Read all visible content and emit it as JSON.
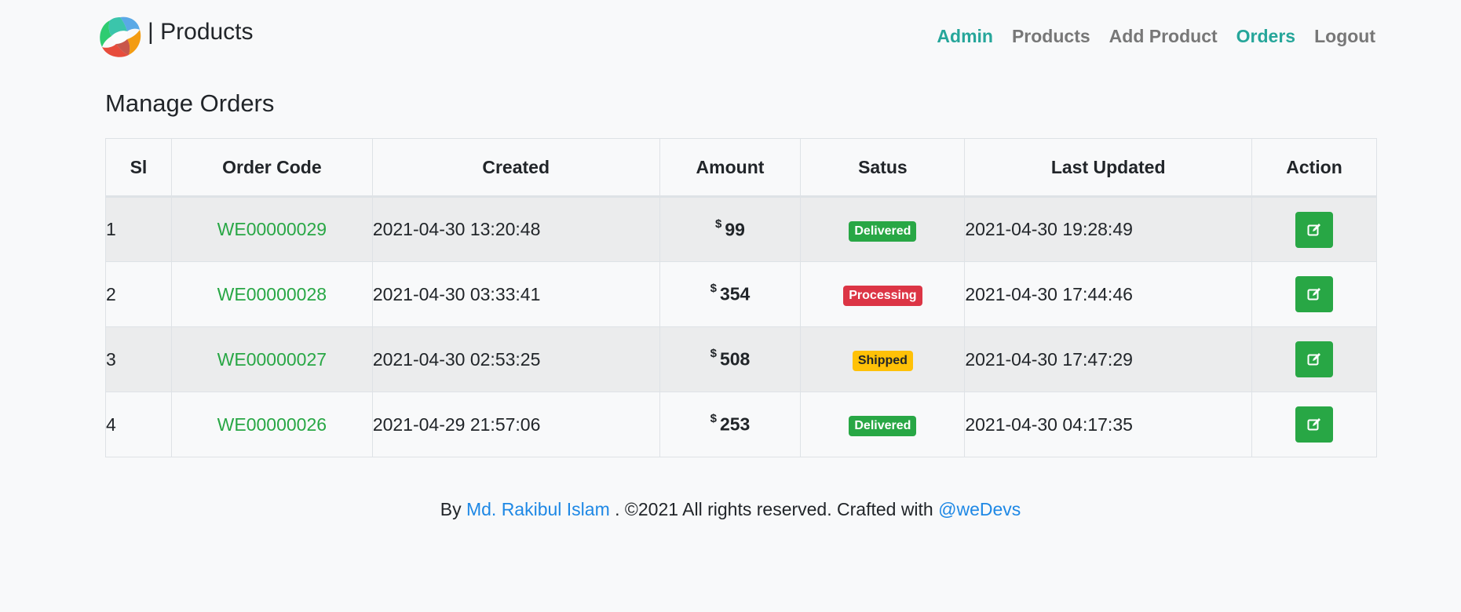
{
  "brand": {
    "title": "| Products",
    "logo_icon": "app-logo-icon"
  },
  "nav": {
    "items": [
      {
        "label": "Admin",
        "active": true
      },
      {
        "label": "Products",
        "active": false
      },
      {
        "label": "Add Product",
        "active": false
      },
      {
        "label": "Orders",
        "active": true
      },
      {
        "label": "Logout",
        "active": false
      }
    ]
  },
  "page": {
    "title": "Manage Orders"
  },
  "table": {
    "headers": [
      "Sl",
      "Order Code",
      "Created",
      "Amount",
      "Satus",
      "Last Updated",
      "Action"
    ],
    "currency_symbol": "$",
    "rows": [
      {
        "sl": "1",
        "code": "WE00000029",
        "created": "2021-04-30 13:20:48",
        "amount": "99",
        "status": "Delivered",
        "status_color": "#28a745",
        "updated": "2021-04-30 19:28:49",
        "action_icon": "edit-icon"
      },
      {
        "sl": "2",
        "code": "WE00000028",
        "created": "2021-04-30 03:33:41",
        "amount": "354",
        "status": "Processing",
        "status_color": "#dc3545",
        "updated": "2021-04-30 17:44:46",
        "action_icon": "edit-icon"
      },
      {
        "sl": "3",
        "code": "WE00000027",
        "created": "2021-04-30 02:53:25",
        "amount": "508",
        "status": "Shipped",
        "status_color": "#ffc107",
        "updated": "2021-04-30 17:47:29",
        "action_icon": "edit-icon"
      },
      {
        "sl": "4",
        "code": "WE00000026",
        "created": "2021-04-29 21:57:06",
        "amount": "253",
        "status": "Delivered",
        "status_color": "#28a745",
        "updated": "2021-04-30 04:17:35",
        "action_icon": "edit-icon"
      }
    ]
  },
  "footer": {
    "prefix": "By",
    "author": "Md. Rakibul Islam",
    "middle": ". ©2021 All rights reserved. Crafted with",
    "crafted_by": "@weDevs"
  },
  "colors": {
    "accent": "#26a69a",
    "link_green": "#28a745",
    "footer_link": "#1e88e5",
    "background": "#f8f9fa"
  }
}
